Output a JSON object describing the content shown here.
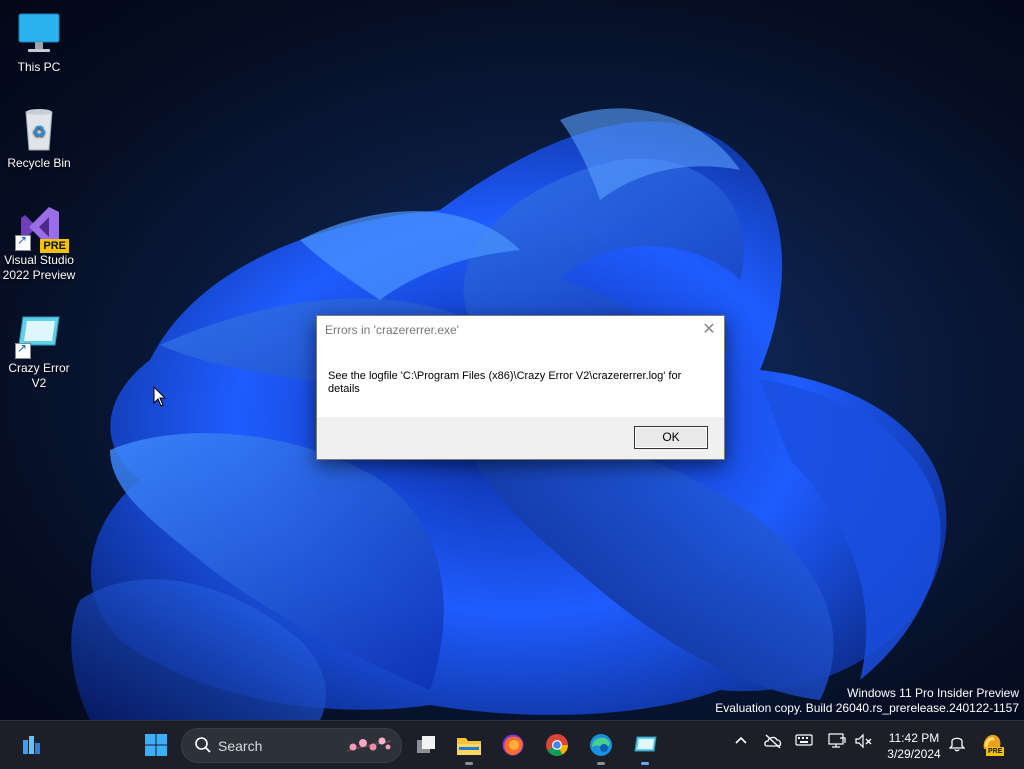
{
  "desktop": {
    "icons": [
      {
        "label": "This PC"
      },
      {
        "label": "Recycle Bin"
      },
      {
        "label": "Visual Studio 2022 Preview",
        "badge": "PRE"
      },
      {
        "label": "Crazy Error V2"
      }
    ]
  },
  "dialog": {
    "title": "Errors in 'crazererrer.exe'",
    "message": "See the logfile 'C:\\Program Files (x86)\\Crazy Error V2\\crazererrer.log' for details",
    "ok_label": "OK",
    "close_icon": "close-icon"
  },
  "watermark": {
    "line1": "Windows 11 Pro Insider Preview",
    "line2": "Evaluation copy. Build 26040.rs_prerelease.240122-1157"
  },
  "taskbar": {
    "search_label": "Search",
    "pinned": [
      "widgets-icon",
      "start-icon",
      "task-view-icon",
      "file-explorer-icon",
      "firefox-icon",
      "chrome-icon",
      "edge-icon",
      "crazy-error-app-icon"
    ],
    "time": "11:42 PM",
    "date": "3/29/2024",
    "copilot_badge": "PRE"
  },
  "colors": {
    "taskbar_bg": "#1c1f27",
    "accent": "#0078d4",
    "wallpaper_blue": "#1f5cff"
  }
}
